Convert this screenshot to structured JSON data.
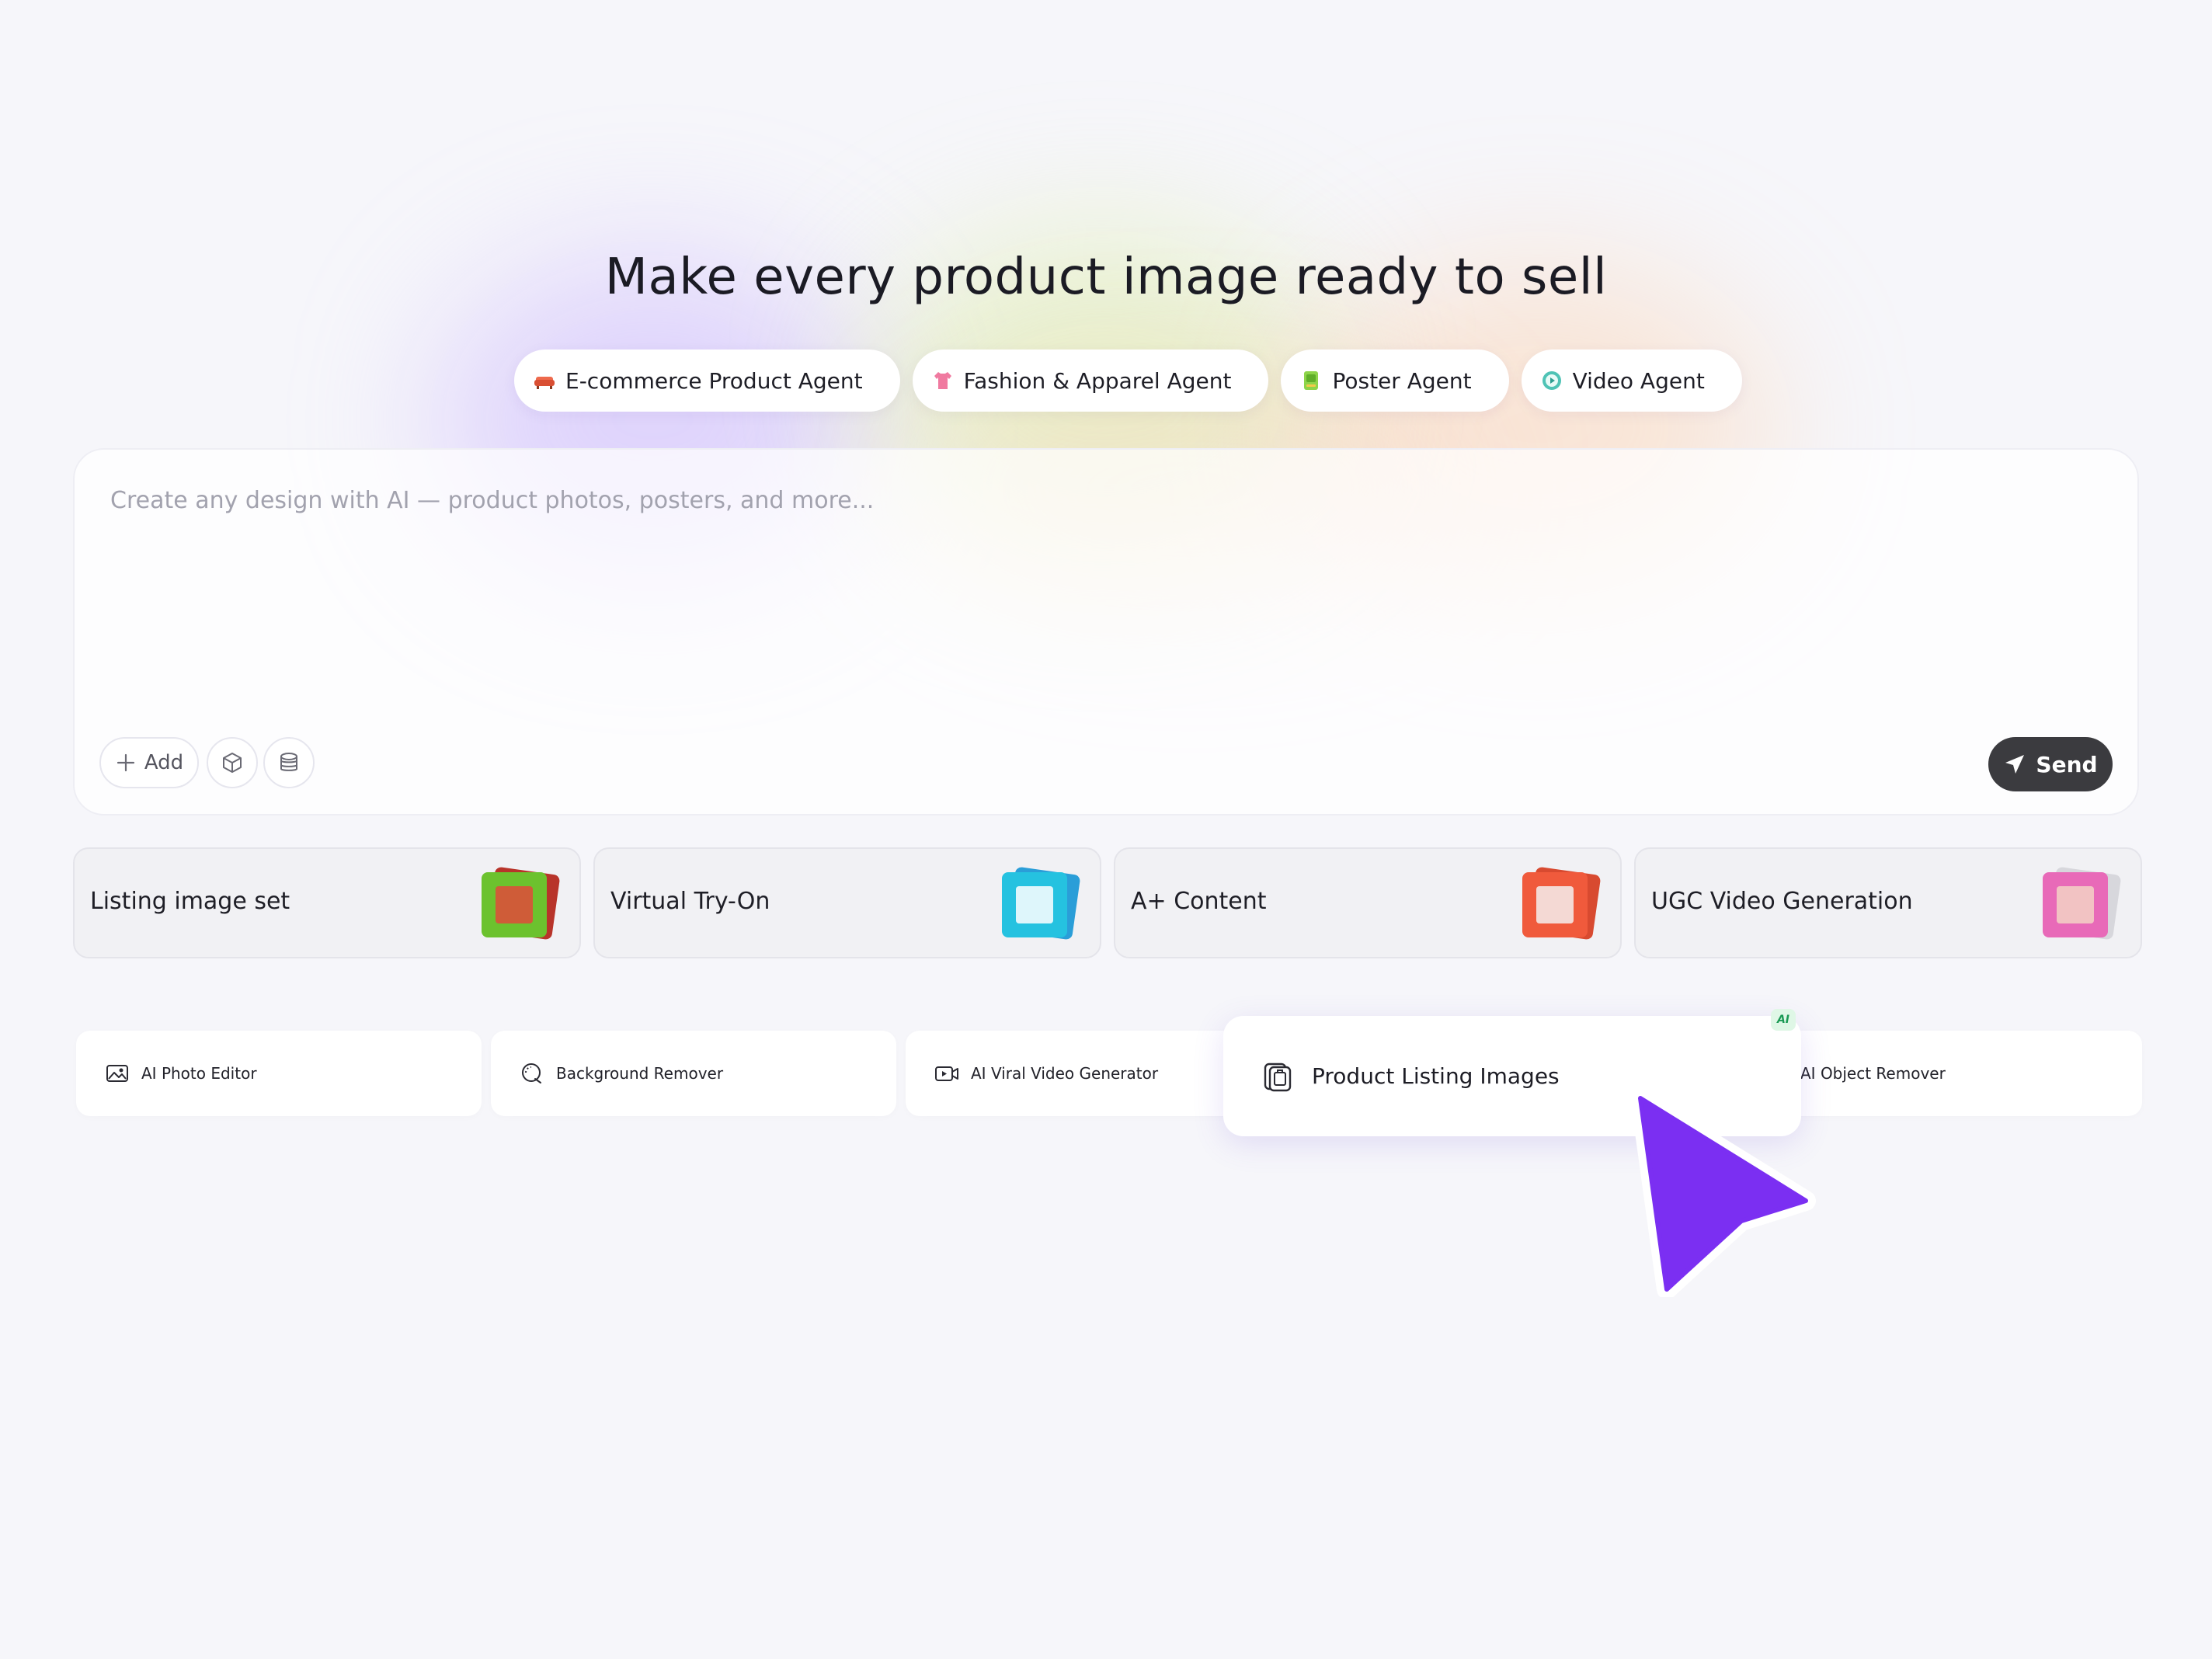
{
  "hero": {
    "title": "Make every product image ready to sell"
  },
  "agents": [
    {
      "label": "E-commerce Product Agent",
      "icon": "sofa-icon",
      "color": "#ee6a4d"
    },
    {
      "label": "Fashion & Apparel Agent",
      "icon": "shirt-icon",
      "color": "#f07aa0"
    },
    {
      "label": "Poster Agent",
      "icon": "poster-icon",
      "color": "#8dd44a"
    },
    {
      "label": "Video Agent",
      "icon": "video-play-icon",
      "color": "#4fc3b5"
    }
  ],
  "prompt": {
    "placeholder": "Create any design with AI — product photos, posters, and more...",
    "add_label": "Add",
    "send_label": "Send"
  },
  "features": [
    {
      "label": "Listing image set",
      "icon": "listing-set-thumbnail",
      "color": "#6cc22e"
    },
    {
      "label": "Virtual Try-On",
      "icon": "try-on-thumbnail",
      "color": "#25c2e0"
    },
    {
      "label": "A+ Content",
      "icon": "aplus-thumbnail",
      "color": "#f05a3c"
    },
    {
      "label": "UGC Video Generation",
      "icon": "ugc-video-thumbnail",
      "color": "#e86ab8"
    }
  ],
  "tools": [
    {
      "label": "AI Photo Editor",
      "icon": "image-edit-icon"
    },
    {
      "label": "Background Remover",
      "icon": "background-remove-icon"
    },
    {
      "label": "AI Viral Video Generator",
      "icon": "video-camera-icon"
    },
    {
      "label": "AI Object Remover",
      "icon": "object-remove-icon"
    }
  ],
  "highlight": {
    "label": "Product Listing Images",
    "badge": "AI",
    "icon": "product-listing-icon",
    "cursor_color": "#7b2ff2"
  }
}
